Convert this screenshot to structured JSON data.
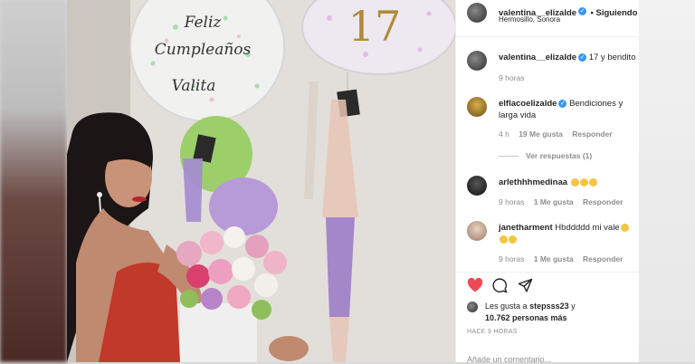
{
  "post": {
    "username": "valentina__elizalde",
    "following_label": "• Siguiendo",
    "location": "Hermosillo, Sonora"
  },
  "balloon": {
    "line1": "Feliz",
    "line2": "Cumpleaños",
    "line3": "Valita",
    "number": "17"
  },
  "caption": {
    "username": "valentina__elizalde",
    "text": "17 y bendito",
    "time": "9 horas"
  },
  "comments": [
    {
      "username": "elflacoelizalde",
      "text": "Bendiciones y",
      "text2": "larga vida",
      "time": "4 h",
      "likes": "19 Me gusta",
      "reply": "Responder",
      "view_replies": "Ver respuestas (1)"
    },
    {
      "username": "arlethhhmedinaa",
      "time": "9 horas",
      "likes": "1 Me gusta",
      "reply": "Responder"
    },
    {
      "username": "janetharment",
      "text": "Hbddddd mi vale",
      "time": "9 horas",
      "likes": "1 Me gusta",
      "reply": "Responder"
    }
  ],
  "likes_summary": {
    "line1_prefix": "Les gusta a",
    "line1_user": "stepsss23",
    "line1_suffix": "y",
    "line2": "10.762 personas más"
  },
  "post_date": "HACE 9 HORAS",
  "add_comment_placeholder": "Añade un comentario...",
  "colors": {
    "verified": "#3897f0",
    "heart": "#ed4956",
    "balloon_purple": "#b79ad8",
    "balloon_green": "#9ccf6a",
    "dress": "#c0392b"
  },
  "icons": [
    "heart-icon",
    "comment-icon",
    "share-icon",
    "verified-icon"
  ]
}
